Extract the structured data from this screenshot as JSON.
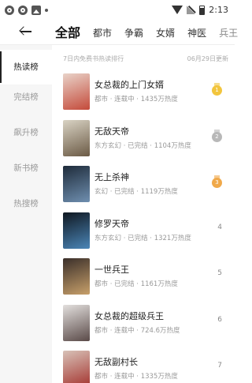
{
  "status_bar": {
    "time": "2:13",
    "left_icons": [
      "notification-icon",
      "notification-icon",
      "image-icon",
      "dot-icon"
    ],
    "right_icons": [
      "wifi-icon",
      "signal-icon",
      "battery-icon"
    ]
  },
  "header": {
    "back_icon": "back-arrow-icon",
    "tabs": [
      {
        "label": "全部",
        "active": true
      },
      {
        "label": "都市",
        "active": false
      },
      {
        "label": "争霸",
        "active": false
      },
      {
        "label": "女婿",
        "active": false
      },
      {
        "label": "神医",
        "active": false
      },
      {
        "label": "兵王",
        "active": false
      }
    ]
  },
  "sidebar": {
    "items": [
      {
        "label": "热读榜",
        "active": true
      },
      {
        "label": "完结榜",
        "active": false
      },
      {
        "label": "飙升榜",
        "active": false
      },
      {
        "label": "新书榜",
        "active": false
      },
      {
        "label": "热搜榜",
        "active": false
      }
    ]
  },
  "list_header": {
    "description": "7日内免费书热读排行",
    "update_date": "06月29日更新"
  },
  "books": [
    {
      "rank": "1",
      "title": "女总裁的上门女婿",
      "meta": "都市 · 连载中 · 1435万热度",
      "medal_color": "#f2c53d",
      "cover_colors": [
        "#e9d3c9",
        "#c44a3a"
      ]
    },
    {
      "rank": "2",
      "title": "无敌天帝",
      "meta": "东方玄幻 · 已完结 · 1104万热度",
      "medal_color": "#b8b8b8",
      "cover_colors": [
        "#d9d3c4",
        "#6b5a45"
      ]
    },
    {
      "rank": "3",
      "title": "无上杀神",
      "meta": "玄幻 · 已完结 · 1119万热度",
      "medal_color": "#f0a94a",
      "cover_colors": [
        "#1e2b3a",
        "#6f8fb0"
      ]
    },
    {
      "rank": "4",
      "title": "修罗天帝",
      "meta": "东方玄幻 · 已完结 · 1321万热度",
      "medal_color": "",
      "cover_colors": [
        "#0f1720",
        "#4b86b8"
      ]
    },
    {
      "rank": "5",
      "title": "一世兵王",
      "meta": "都市 · 已完结 · 1161万热度",
      "medal_color": "",
      "cover_colors": [
        "#3a2f2a",
        "#c8a06a"
      ]
    },
    {
      "rank": "6",
      "title": "女总裁的超级兵王",
      "meta": "都市 · 连载中 · 724.6万热度",
      "medal_color": "",
      "cover_colors": [
        "#e3e0de",
        "#5a4a48"
      ]
    },
    {
      "rank": "7",
      "title": "无敌副村长",
      "meta": "都市 · 连载中 · 1335万热度",
      "medal_color": "",
      "cover_colors": [
        "#d8c2b8",
        "#a4332e"
      ]
    }
  ]
}
